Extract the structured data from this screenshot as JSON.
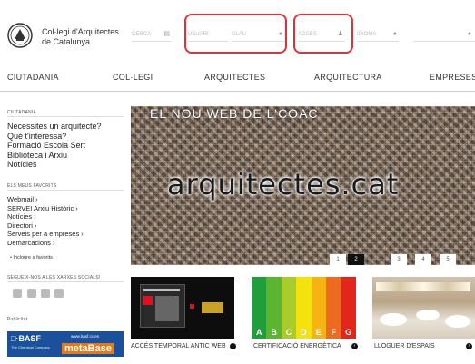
{
  "header": {
    "brand_line1": "Col·legi d'Arquitectes",
    "brand_line2": "de Catalunya",
    "search_placeholder": "CERCA",
    "user_placeholder": "USUARI",
    "key_placeholder": "CLAU",
    "access_placeholder": "ACCES",
    "idioma_placeholder": "IDIOMA"
  },
  "nav": {
    "items": [
      "CIUTADANIA",
      "COL·LEGI",
      "ARQUITECTES",
      "ARQUITECTURA",
      "EMPRESES"
    ]
  },
  "sidebar": {
    "ciutadania_heading": "CIUTADANIA",
    "ciutadania_links": [
      "Necessites un arquitecte?",
      "Què t'interessa?",
      "Formació Escola Sert",
      "Biblioteca i Arxiu",
      "Notícies"
    ],
    "favorits_heading": "ELS MEUS FAVORITS",
    "favorits_links": [
      "Webmail",
      "SERVEI Arxiu Històric",
      "Notícies",
      "Directori",
      "Serveis per a empreses",
      "Demarcacions"
    ],
    "incloure_favorits": "Incloure a favorits",
    "social_heading": "SEGUEIX-NOS A LES XARXES SOCIALS!",
    "publicitat_heading": "Publicitat",
    "ad_brand": "BASF",
    "ad_tagline": "The Chemical Company",
    "ad_url": "www.basf.cc.es",
    "ad_product": "metaBase"
  },
  "hero": {
    "overlay_text": "EL NOU WEB DE L'COAC",
    "big_text": "arquitectes.cat",
    "pager": [
      "1",
      "2",
      "3",
      "4",
      "5"
    ],
    "active_page": "2"
  },
  "thumbs": [
    {
      "caption": "ACCÉS TEMPORAL ANTIC WEB"
    },
    {
      "caption": "CERTIFICACIÓ ENERGÈTICA"
    },
    {
      "caption": "LLOGUER D'ESPAIS"
    }
  ],
  "energy_labels": [
    "A",
    "B",
    "C",
    "D",
    "E",
    "F",
    "G"
  ],
  "colors": {
    "highlight": "#e0303a",
    "energy": [
      "#1f9e3a",
      "#5cb531",
      "#a8cc2c",
      "#f2e20d",
      "#f5b414",
      "#ec6b1e",
      "#e1261c"
    ]
  }
}
